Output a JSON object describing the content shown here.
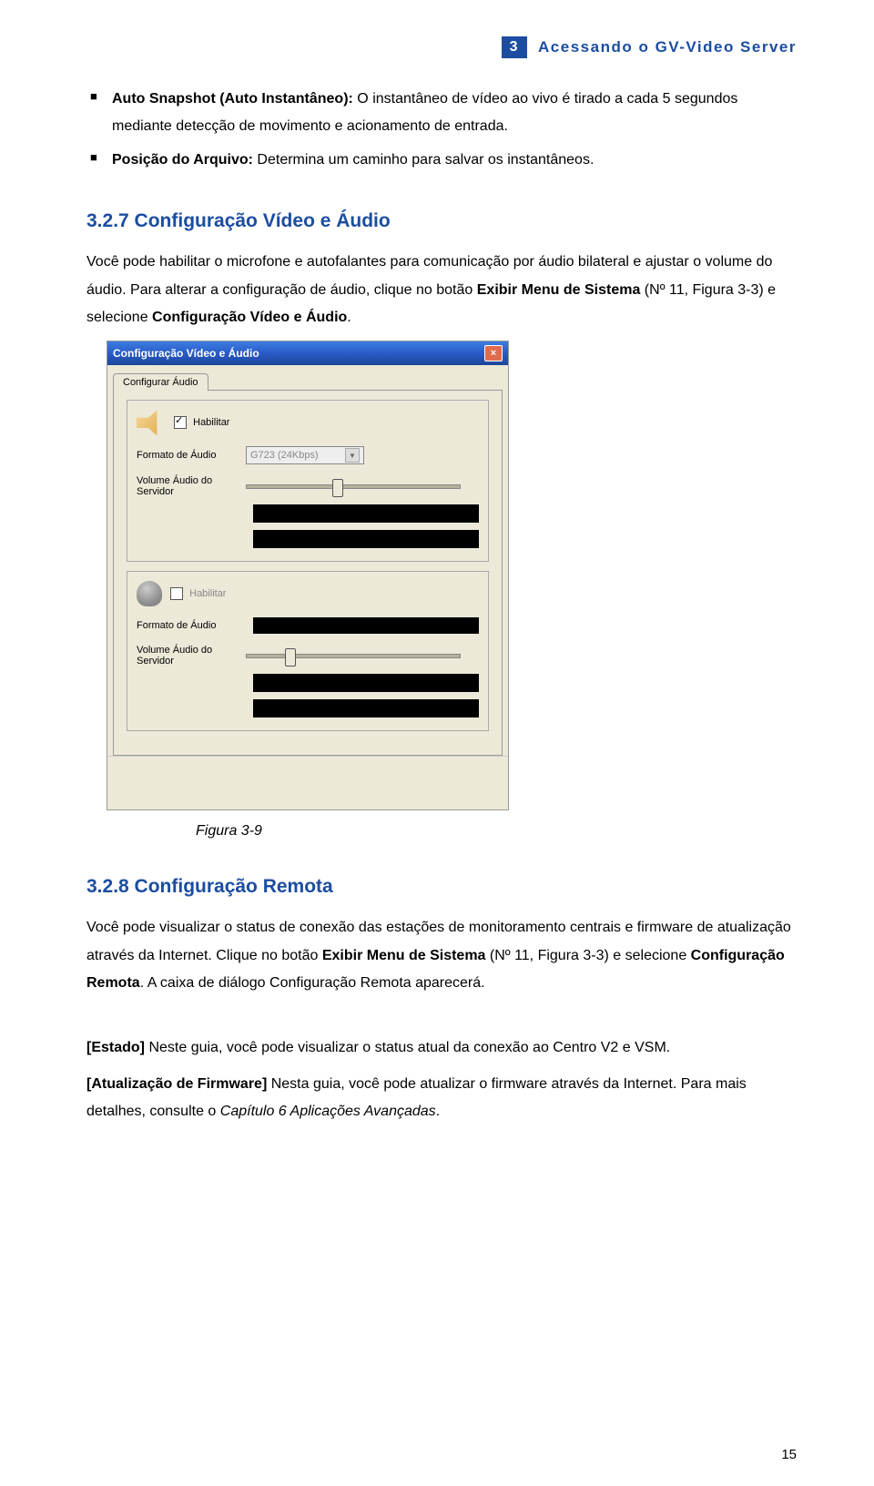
{
  "header": {
    "chapter_num": "3",
    "chapter_title": "Acessando o GV-Video Server"
  },
  "bullets": [
    {
      "bold": "Auto Snapshot (Auto Instantâneo):",
      "rest": " O instantâneo de vídeo ao vivo é tirado a cada 5 segundos mediante detecção de movimento e acionamento de entrada."
    },
    {
      "bold": "Posição do Arquivo:",
      "rest": " Determina um caminho para salvar os instantâneos."
    }
  ],
  "section327": {
    "heading": "3.2.7  Configuração Vídeo e Áudio",
    "p1a": "Você pode habilitar o microfone e autofalantes para comunicação por áudio bilateral e ajustar o volume do áudio. Para alterar a configuração de áudio, clique no botão ",
    "p1b": "Exibir Menu de Sistema",
    "p1c": " (Nº 11, Figura 3-3) e selecione ",
    "p1d": "Configuração Vídeo e Áudio",
    "p1e": "."
  },
  "dialog": {
    "title": "Configuração Vídeo e Áudio",
    "tab": "Configurar Áudio",
    "enable": "Habilitar",
    "format_label": "Formato de Áudio",
    "format_value": "G723 (24Kbps)",
    "vol_label": "Volume Áudio do Servidor"
  },
  "fig39": "Figura 3-9",
  "section328": {
    "heading": "3.2.8  Configuração Remota",
    "p1a": "Você pode visualizar o status de conexão das estações de monitoramento centrais e firmware de atualização através da Internet. Clique no botão ",
    "p1b": "Exibir Menu de Sistema",
    "p1c": " (Nº 11, Figura 3-3) e selecione ",
    "p1d": "Configuração Remota",
    "p1e": ". A caixa de diálogo Configuração Remota aparecerá.",
    "p2a": "[Estado]",
    "p2b": " Neste guia, você pode visualizar o status atual da conexão ao Centro V2 e VSM.",
    "p3a": "[Atualização de Firmware]",
    "p3b": " Nesta guia, você pode atualizar o firmware através da Internet. Para mais detalhes, consulte o ",
    "p3c": "Capítulo 6 Aplicações Avançadas",
    "p3d": "."
  },
  "pagenum": "15"
}
